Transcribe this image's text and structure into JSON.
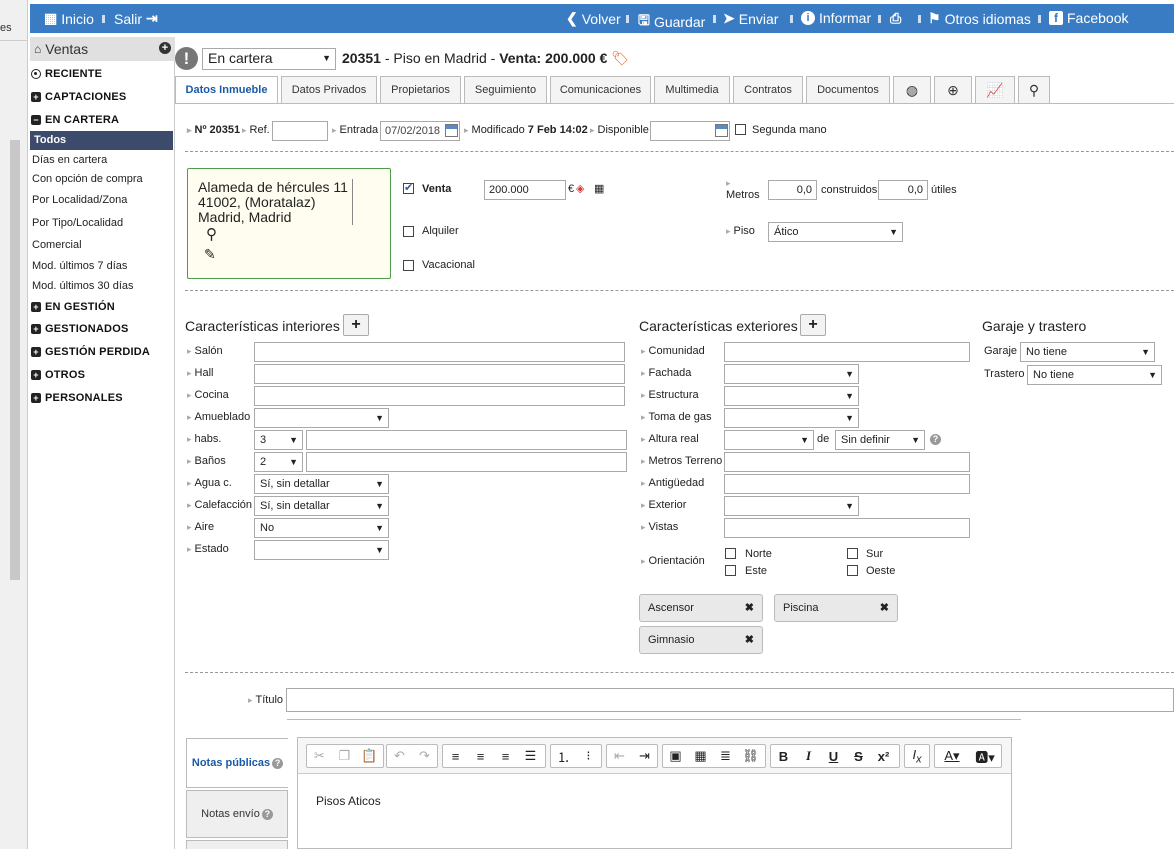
{
  "strip": {
    "partial_text": "es"
  },
  "topbar": {
    "inicio": "Inicio",
    "salir": "Salir",
    "volver": "Volver",
    "guardar": "Guardar",
    "enviar": "Enviar",
    "informar": "Informar",
    "otros": "Otros idiomas",
    "facebook": "Facebook"
  },
  "sidebar": {
    "title": "Ventas",
    "reciente": "RECIENTE",
    "captaciones": "CAPTACIONES",
    "en_cartera": "EN CARTERA",
    "items": [
      "Todos",
      "Días en cartera",
      "Con opción de compra",
      "Por Localidad/Zona",
      "Por Tipo/Localidad",
      "Comercial",
      "Mod. últimos 7 días",
      "Mod. últimos 30 días"
    ],
    "en_gestion": "EN GESTIÓN",
    "gestionados": "GESTIONADOS",
    "gestion_perdida": "GESTIÓN PERDIDA",
    "otros": "OTROS",
    "personales": "PERSONALES"
  },
  "header": {
    "status": "En cartera",
    "number": "20351",
    "title": " - Piso en Madrid - ",
    "price": "Venta: 200.000 €"
  },
  "tabs": [
    "Datos Inmueble",
    "Datos Privados",
    "Propietarios",
    "Seguimiento",
    "Comunicaciones",
    "Multimedia",
    "Contratos",
    "Documentos"
  ],
  "row1": {
    "num": "Nº 20351",
    "ref": "Ref.",
    "entrada": "Entrada",
    "entrada_val": "07/02/2018",
    "modificado": "Modificado",
    "modificado_val": "7 Feb 14:02",
    "disponible": "Disponible",
    "segunda": "Segunda mano"
  },
  "address": {
    "line1": "Alameda de hércules 11",
    "line2": "41002, (Moratalaz)",
    "line3": "Madrid, Madrid"
  },
  "ops": {
    "venta": "Venta",
    "venta_val": "200.000",
    "currency": "€",
    "alquiler": "Alquiler",
    "vacacional": "Vacacional",
    "metros": "Metros",
    "construidos_val": "0,0",
    "construidos": "construidos",
    "utiles_val": "0,0",
    "utiles": "útiles",
    "piso": "Piso",
    "piso_val": "Ático"
  },
  "interiores": {
    "title": "Características interiores",
    "salon": "Salón",
    "hall": "Hall",
    "cocina": "Cocina",
    "amueblado": "Amueblado",
    "habs": "habs.",
    "habs_val": "3",
    "banos": "Baños",
    "banos_val": "2",
    "agua": "Agua c.",
    "agua_val": "Sí, sin detallar",
    "calefaccion": "Calefacción",
    "calefaccion_val": "Sí, sin detallar",
    "aire": "Aire",
    "aire_val": "No",
    "estado": "Estado"
  },
  "exteriores": {
    "title": "Características exteriores",
    "comunidad": "Comunidad",
    "fachada": "Fachada",
    "estructura": "Estructura",
    "toma_gas": "Toma de gas",
    "altura": "Altura real",
    "de": "de",
    "altura_val": "Sin definir",
    "metros_terreno": "Metros Terreno",
    "antiguedad": "Antigüedad",
    "exterior": "Exterior",
    "vistas": "Vistas",
    "orientacion": "Orientación",
    "norte": "Norte",
    "sur": "Sur",
    "este": "Este",
    "oeste": "Oeste",
    "chips": [
      "Ascensor",
      "Piscina",
      "Gimnasio"
    ]
  },
  "garaje": {
    "title": "Garaje y trastero",
    "garaje": "Garaje",
    "garaje_val": "No tiene",
    "trastero": "Trastero",
    "trastero_val": "No tiene"
  },
  "titulo": {
    "label": "Título"
  },
  "notes": {
    "publicas": "Notas públicas",
    "envio": "Notas envío",
    "content": "Pisos Aticos"
  }
}
